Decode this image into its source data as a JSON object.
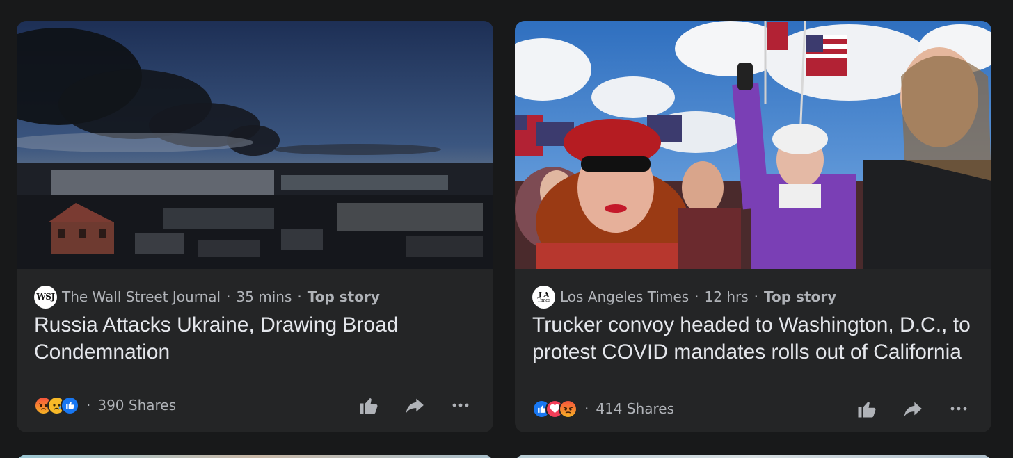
{
  "feed": {
    "cards": [
      {
        "source_name": "The Wall Street Journal",
        "source_logo_text": "WSJ",
        "time_ago": "35 mins",
        "tag": "Top story",
        "separator": "·",
        "headline": "Russia Attacks Ukraine, Drawing Broad Condemnation",
        "reactions": [
          "angry",
          "sad",
          "like"
        ],
        "shares": "390 Shares",
        "image_subject": "city-skyline-with-smoke"
      },
      {
        "source_name": "Los Angeles Times",
        "source_logo_text": "LA",
        "source_logo_subtext": "Times",
        "time_ago": "12 hrs",
        "tag": "Top story",
        "separator": "·",
        "headline": "Trucker convoy headed to Washington, D.C., to protest COVID mandates rolls out of California",
        "reactions": [
          "like",
          "love",
          "angry"
        ],
        "shares": "414 Shares",
        "image_subject": "crowd-with-american-flags"
      }
    ]
  },
  "icons": {
    "like": "thumbs-up-icon",
    "share": "share-arrow-icon",
    "more": "more-dots-icon"
  },
  "colors": {
    "background": "#18191a",
    "card": "#242526",
    "text_primary": "#e4e6eb",
    "text_secondary": "#b0b3b8",
    "like_blue": "#1877f2",
    "love_red": "#f33e58",
    "sad_yellow": "#f7b928"
  }
}
